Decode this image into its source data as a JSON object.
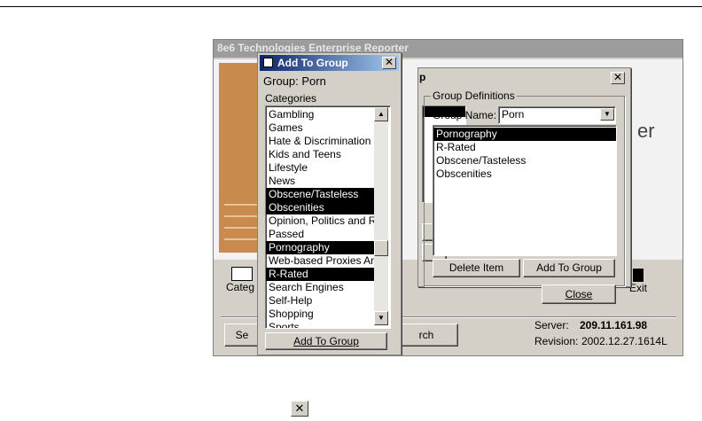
{
  "app": {
    "title": "8e6 Technologies Enterprise Reporter",
    "brand_fragment": "er"
  },
  "toolbar": {
    "categories_label": "Categ",
    "exit_label": "Exit"
  },
  "status": {
    "server_label": "Server:",
    "server_value": "209.11.161.98",
    "revision_label": "Revision:",
    "revision_value": "2002.12.27.1614L"
  },
  "bottom_buttons": {
    "left_partial": "Se",
    "search_partial": "rch"
  },
  "group_dialog": {
    "title_partial": "p",
    "group_definitions_label": "Group Definitions",
    "group_name_label": "Group Name:",
    "group_name_value": "Porn",
    "items": [
      {
        "label": "Pornography",
        "selected": true
      },
      {
        "label": "R-Rated",
        "selected": false
      },
      {
        "label": "Obscene/Tasteless",
        "selected": false
      },
      {
        "label": "Obscenities",
        "selected": false
      }
    ],
    "delete_item_label": "Delete Item",
    "add_to_group_label": "Add To Group",
    "close_label": "Close"
  },
  "add_dialog": {
    "title": "Add To Group",
    "group_label": "Group: Porn",
    "categories_label": "Categories",
    "categories": [
      {
        "label": "Gambling",
        "selected": false
      },
      {
        "label": "Games",
        "selected": false
      },
      {
        "label": "Hate & Discrimination",
        "selected": false
      },
      {
        "label": "Kids and Teens",
        "selected": false
      },
      {
        "label": "Lifestyle",
        "selected": false
      },
      {
        "label": "News",
        "selected": false
      },
      {
        "label": "Obscene/Tasteless",
        "selected": true
      },
      {
        "label": "Obscenities",
        "selected": true
      },
      {
        "label": "Opinion, Politics and Re",
        "selected": false
      },
      {
        "label": "Passed",
        "selected": false
      },
      {
        "label": "Pornography",
        "selected": true
      },
      {
        "label": "Web-based Proxies An",
        "selected": false
      },
      {
        "label": "R-Rated",
        "selected": true
      },
      {
        "label": "Search Engines",
        "selected": false
      },
      {
        "label": "Self-Help",
        "selected": false
      },
      {
        "label": "Shopping",
        "selected": false
      },
      {
        "label": "Sports",
        "selected": false
      }
    ],
    "add_button_label": "Add To Group"
  },
  "icons": {
    "close_glyph": "✕",
    "scroll_up": "▲",
    "scroll_down": "▼",
    "combo_arrow": "▼"
  }
}
